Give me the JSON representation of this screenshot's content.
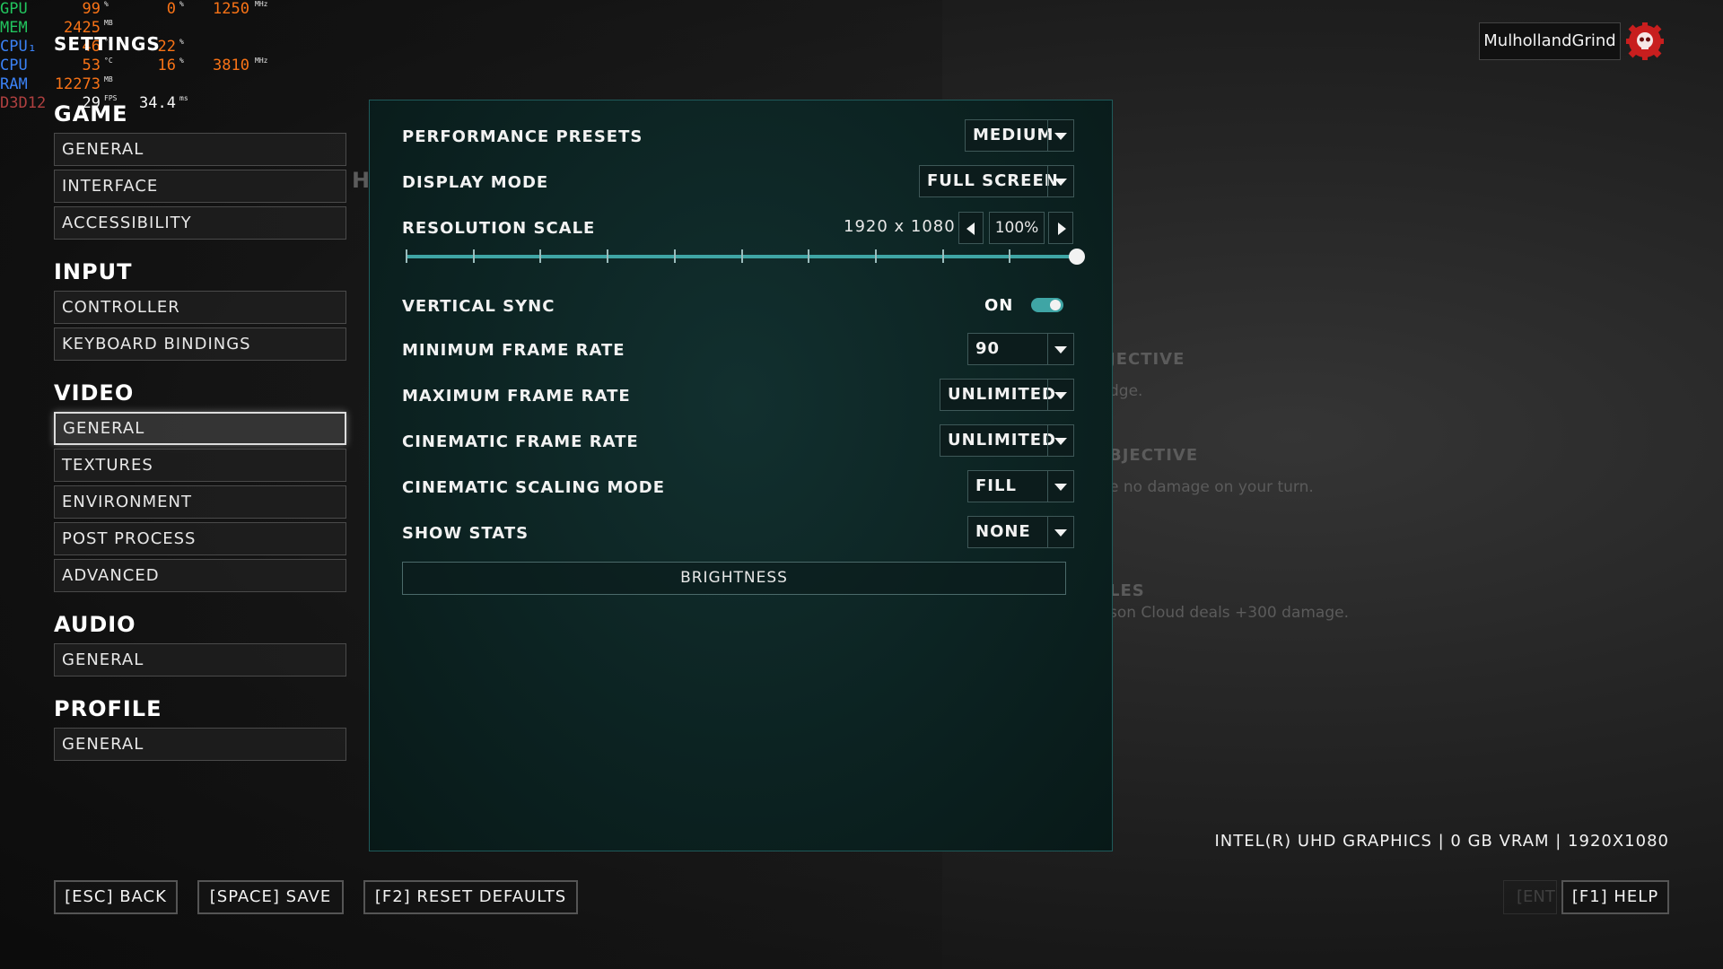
{
  "overlay": {
    "gpu": {
      "label": "GPU",
      "v1": "99",
      "u1": "%",
      "v2": "0",
      "u2": "%",
      "v3": "1250",
      "u3": "MHz"
    },
    "mem": {
      "label": "MEM",
      "v1": "2425",
      "u1": "MB"
    },
    "cpu1": {
      "label": "CPU₁",
      "v1": "46",
      "u1": "°C",
      "v2": "22",
      "u2": "%"
    },
    "cpu": {
      "label": "CPU",
      "v1": "53",
      "u1": "°C",
      "v2": "16",
      "u2": "%",
      "v3": "3810",
      "u3": "MHz"
    },
    "ram": {
      "label": "RAM",
      "v1": "12273",
      "u1": "MB"
    },
    "d3d": {
      "label": "D3D12",
      "v1": "29",
      "u1": "FPS",
      "v2": "34.4",
      "u2": "ms"
    }
  },
  "header": {
    "title": "SETTINGS"
  },
  "user": {
    "name": "MulhollandGrind"
  },
  "sidebar": {
    "game": {
      "title": "GAME",
      "items": [
        "GENERAL",
        "INTERFACE",
        "ACCESSIBILITY"
      ]
    },
    "input": {
      "title": "INPUT",
      "items": [
        "CONTROLLER",
        "KEYBOARD BINDINGS"
      ]
    },
    "video": {
      "title": "VIDEO",
      "items": [
        "GENERAL",
        "TEXTURES",
        "ENVIRONMENT",
        "POST PROCESS",
        "ADVANCED"
      ],
      "active": "GENERAL"
    },
    "audio": {
      "title": "AUDIO",
      "items": [
        "GENERAL"
      ]
    },
    "profile": {
      "title": "PROFILE",
      "items": [
        "GENERAL"
      ]
    }
  },
  "settings": {
    "performance_presets": {
      "label": "PERFORMANCE PRESETS",
      "value": "MEDIUM"
    },
    "display_mode": {
      "label": "DISPLAY MODE",
      "value": "FULL SCREEN"
    },
    "resolution_scale": {
      "label": "RESOLUTION SCALE",
      "resolution": "1920 x 1080",
      "value": "100%",
      "fraction": 1.0
    },
    "vertical_sync": {
      "label": "VERTICAL SYNC",
      "value": "ON",
      "enabled": true
    },
    "min_frame_rate": {
      "label": "MINIMUM FRAME RATE",
      "value": "90"
    },
    "max_frame_rate": {
      "label": "MAXIMUM FRAME RATE",
      "value": "UNLIMITED"
    },
    "cinematic_frame_rate": {
      "label": "CINEMATIC FRAME RATE",
      "value": "UNLIMITED"
    },
    "cinematic_scaling_mode": {
      "label": "CINEMATIC SCALING MODE",
      "value": "FILL"
    },
    "show_stats": {
      "label": "SHOW STATS",
      "value": "NONE"
    },
    "brightness": {
      "label": "BRIGHTNESS"
    }
  },
  "background": {
    "h_fragment": "H",
    "obj1_title": "JECTIVE",
    "obj1_text": "dge.",
    "obj2_title": "BJECTIVE",
    "obj2_text": "e no damage on your turn.",
    "obj3_title": "LES",
    "obj3_text": "son Cloud deals +300 damage.",
    "ent_fragment": "[ENT"
  },
  "gpu_info": "INTEL(R) UHD GRAPHICS | 0 GB VRAM | 1920X1080",
  "footer": {
    "back": "[ESC] BACK",
    "save": "[SPACE] SAVE",
    "reset": "[F2] RESET DEFAULTS",
    "help": "[F1] HELP"
  },
  "colors": {
    "accent": "#3fa5a5",
    "panel": "#0c2322",
    "overlay_orange": "#f97316",
    "overlay_green": "#22c55e",
    "overlay_blue": "#3b82f6"
  }
}
